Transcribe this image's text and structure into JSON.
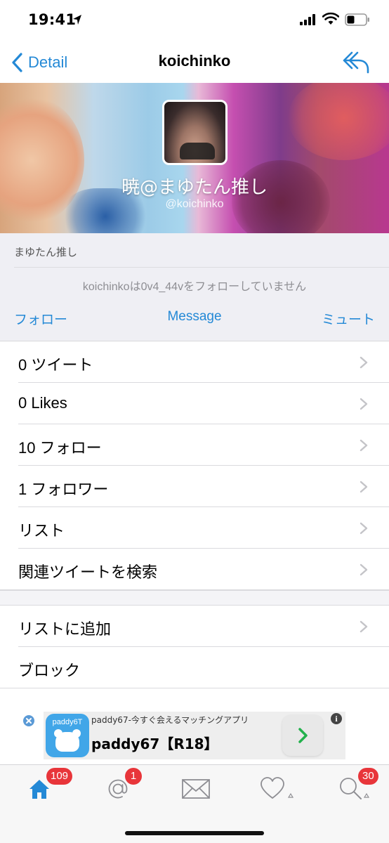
{
  "status_bar": {
    "time": "19:41"
  },
  "nav": {
    "back_label": "Detail",
    "title": "koichinko"
  },
  "profile": {
    "display_name": "暁@まゆたん推し",
    "handle": "@koichinko",
    "bio": "まゆたん推し",
    "relationship": "koichinkoは0v4_44vをフォローしていません"
  },
  "actions": {
    "follow": "フォロー",
    "message": "Message",
    "mute": "ミュート"
  },
  "menu": [
    {
      "label": "0 ツイート"
    },
    {
      "label": "0 Likes"
    },
    {
      "label": "10 フォロー"
    },
    {
      "label": "1 フォロワー"
    },
    {
      "label": "リスト"
    },
    {
      "label": "関連ツイートを検索"
    }
  ],
  "menu2": [
    {
      "label": "リストに追加"
    },
    {
      "label": "ブロック"
    }
  ],
  "ad": {
    "brand": "paddy6T",
    "subtitle": "paddy67-今すぐ会えるマッチングアプリ",
    "title": "paddy67【R18】",
    "info": "i"
  },
  "tabbar": {
    "home_badge": "109",
    "mentions_badge": "1",
    "search_badge": "30"
  },
  "colors": {
    "accent": "#2489d6",
    "badge": "#e8353a",
    "info_bg": "#efeff4"
  }
}
